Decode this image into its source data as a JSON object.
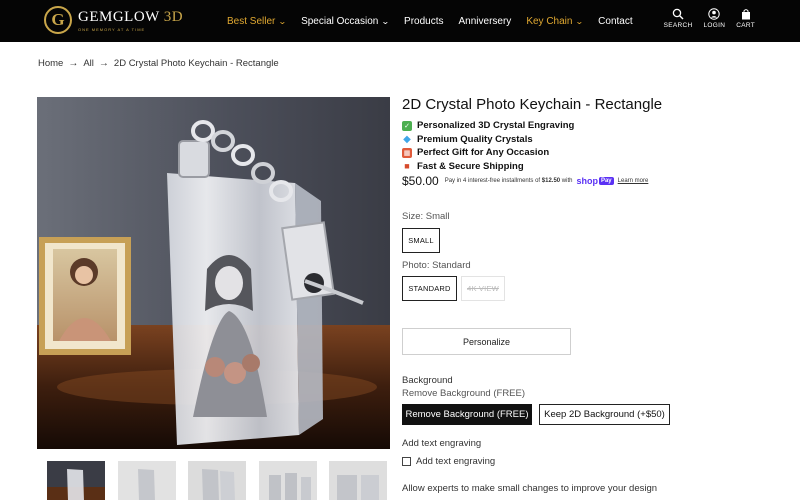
{
  "brand": {
    "logo_letter": "G",
    "name": "GEMGLOW",
    "name_suffix": "3D",
    "tagline": "ONE MEMORY AT A TIME"
  },
  "nav": [
    {
      "label": "Best Seller",
      "dropdown": true,
      "highlight": true
    },
    {
      "label": "Special Occasion",
      "dropdown": true,
      "highlight": false
    },
    {
      "label": "Products",
      "dropdown": false,
      "highlight": false
    },
    {
      "label": "Anniversery",
      "dropdown": false,
      "highlight": false
    },
    {
      "label": "Key Chain",
      "dropdown": true,
      "highlight": true
    },
    {
      "label": "Contact",
      "dropdown": false,
      "highlight": false
    }
  ],
  "header_icons": {
    "search": {
      "label": "SEARCH",
      "icon": "search-icon"
    },
    "login": {
      "label": "LOGIN",
      "icon": "user-icon"
    },
    "cart": {
      "label": "CART",
      "icon": "bag-icon"
    }
  },
  "breadcrumb": [
    "Home",
    "All",
    "2D Crystal Photo Keychain - Rectangle"
  ],
  "product": {
    "title": "2D Crystal Photo Keychain - Rectangle",
    "features": [
      {
        "icon": "check-icon",
        "text": "Personalized 3D Crystal Engraving"
      },
      {
        "icon": "gem-icon",
        "text": "Premium Quality Crystals"
      },
      {
        "icon": "gift-icon",
        "text": "Perfect Gift for Any Occasion"
      },
      {
        "icon": "truck-icon",
        "text": "Fast & Secure Shipping"
      }
    ],
    "price": "$50.00",
    "installments_prefix": "Pay in 4 interest-free installments of",
    "installment_amount": "$12.50",
    "installments_with": "with",
    "shop_pay_word": "shop",
    "shop_pay_box": "Pay",
    "learn_more": "Learn more"
  },
  "size": {
    "label": "Size: Small",
    "options": [
      {
        "label": "SMALL",
        "selected": true
      }
    ]
  },
  "photo": {
    "label": "Photo: Standard",
    "options": [
      {
        "label": "STANDARD",
        "selected": true,
        "disabled": false
      },
      {
        "label": "4K VIEW",
        "selected": false,
        "disabled": true
      }
    ]
  },
  "personalize_label": "Personalize",
  "background": {
    "label": "Background",
    "current": "Remove Background (FREE)",
    "options": [
      {
        "label": "Remove Background (FREE)",
        "selected": true
      },
      {
        "label": "Keep 2D Background (+$50)",
        "selected": false
      }
    ]
  },
  "engraving": {
    "label": "Add text engraving",
    "checkbox_label": "Add text engraving",
    "checked": false
  },
  "experts_text": "Allow experts to make small changes to improve your design",
  "colors": {
    "header_bg": "#050505",
    "nav_highlight": "#e0a831",
    "brand_gold": "#c9a64a",
    "shop_pay": "#5a31f4"
  }
}
